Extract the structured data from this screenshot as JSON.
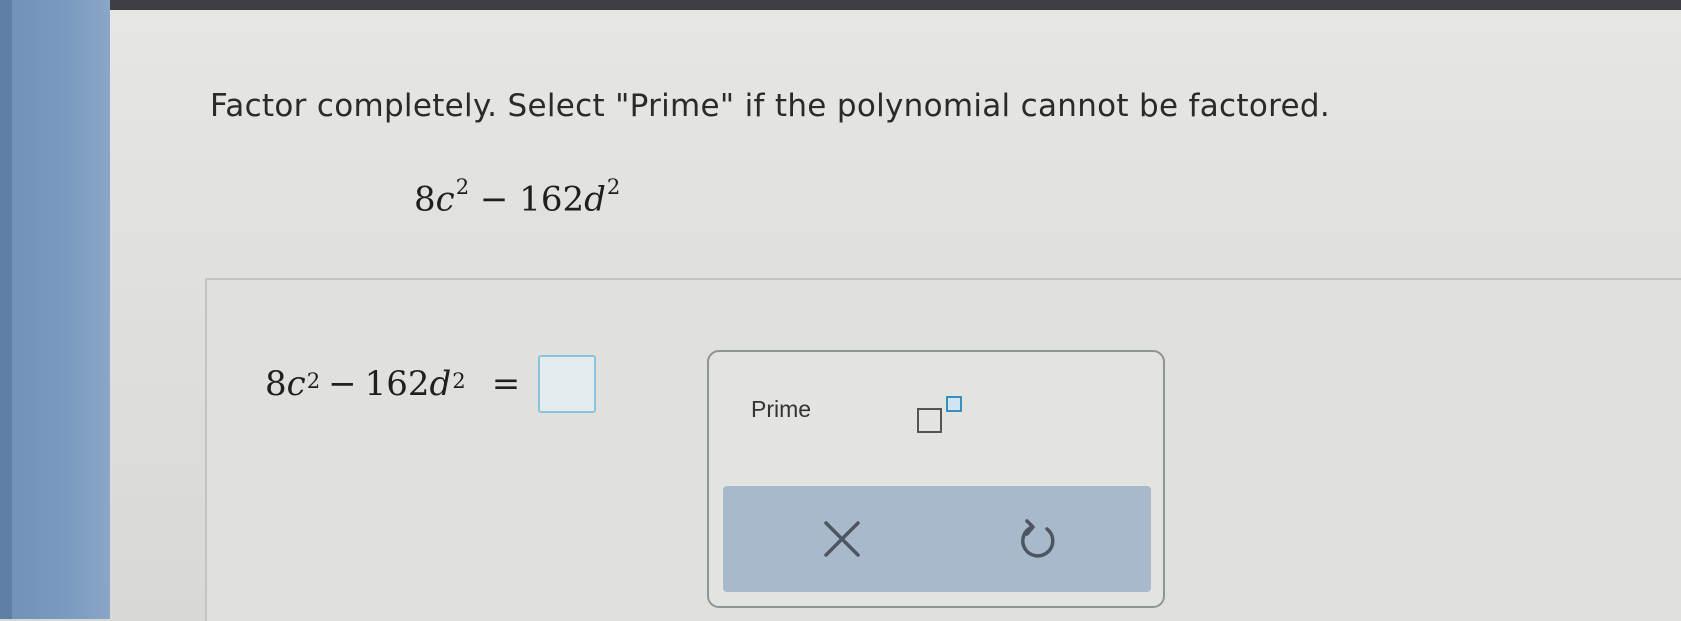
{
  "instructions": "Factor completely. Select \"Prime\" if the polynomial cannot be factored.",
  "problem": {
    "coef1": "8",
    "var1": "c",
    "exp1": "2",
    "operator": "−",
    "coef2": "162",
    "var2": "d",
    "exp2": "2"
  },
  "equation": {
    "equals": "="
  },
  "keypad": {
    "prime_label": "Prime"
  }
}
